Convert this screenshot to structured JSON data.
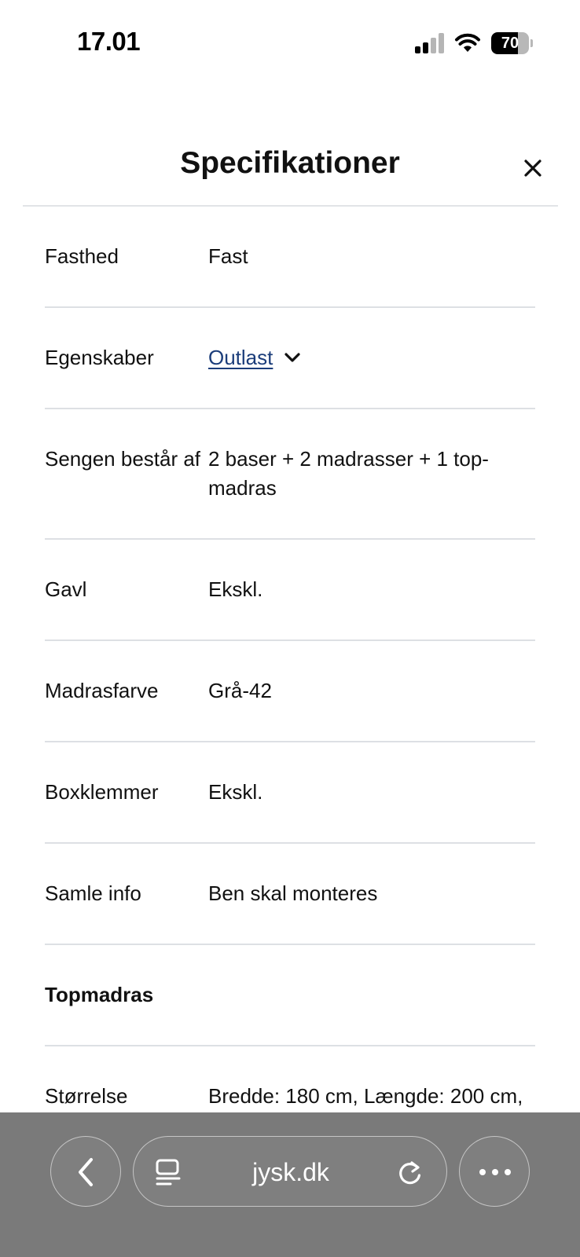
{
  "status_bar": {
    "time": "17.01",
    "battery_level": "70",
    "battery_fraction": 0.7
  },
  "header": {
    "title": "Specifikationer",
    "close_icon": "close-icon"
  },
  "specs": [
    {
      "label": "Fasthed",
      "value": "Fast"
    },
    {
      "label": "Egenskaber",
      "value": "Outlast",
      "link": true,
      "icon": "chevron-down-icon"
    },
    {
      "label": "Sengen består af",
      "value": "2 baser + 2 madrasser + 1 top-madras"
    },
    {
      "label": "Gavl",
      "value": "Ekskl."
    },
    {
      "label": "Madrasfarve",
      "value": "Grå-42"
    },
    {
      "label": "Boxklemmer",
      "value": "Ekskl."
    },
    {
      "label": "Samle info",
      "value": "Ben skal monteres"
    },
    {
      "label": "Topmadras",
      "value": ""
    },
    {
      "label": "Størrelse",
      "value": "Bredde: 180 cm, Længde: 200 cm,"
    }
  ],
  "browser_bar": {
    "url": "jysk.dk",
    "back_icon": "chevron-left-icon",
    "reader_icon": "reader-icon",
    "reload_icon": "reload-icon",
    "more_icon": "more-icon"
  },
  "colors": {
    "link": "#1b3d7a",
    "divider": "#dde0e4",
    "bottom_bar": "#7a7a7a"
  }
}
